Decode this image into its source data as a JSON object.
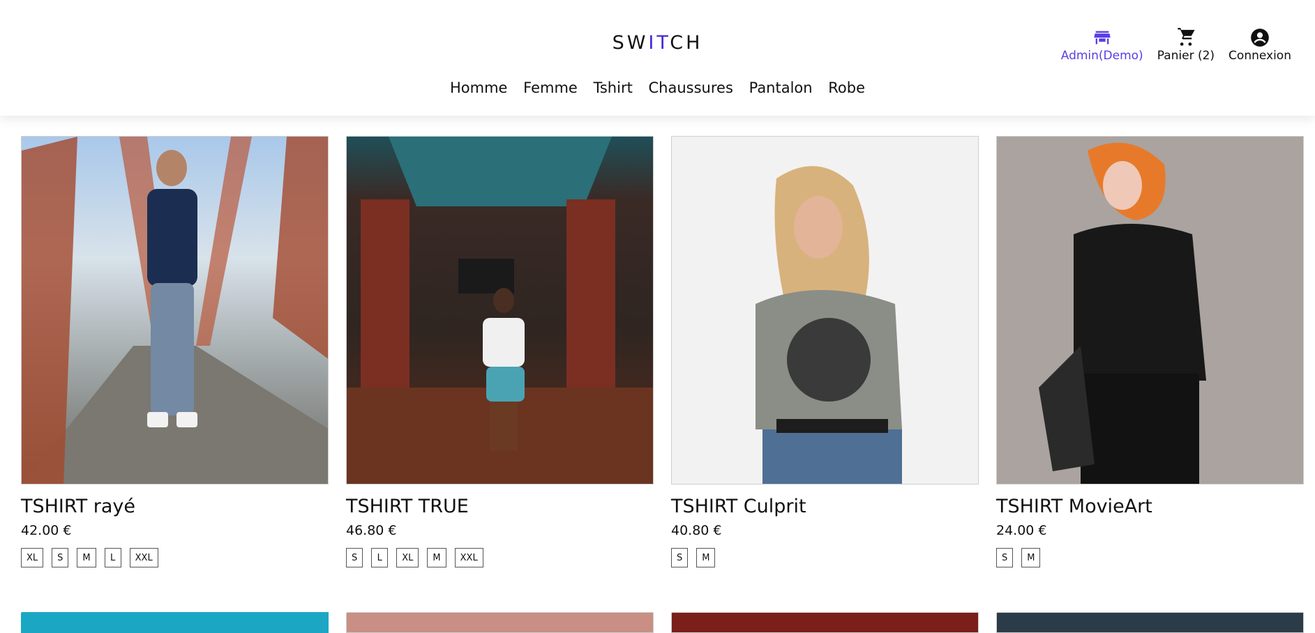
{
  "header": {
    "logo": {
      "part1": "SW",
      "accent": "IT",
      "part2": "CH"
    },
    "nav": [
      "Homme",
      "Femme",
      "Tshirt",
      "Chaussures",
      "Pantalon",
      "Robe"
    ],
    "actions": {
      "admin": {
        "label": "Admin(Demo)",
        "icon": "store-icon"
      },
      "cart": {
        "label": "Panier (2)",
        "icon": "cart-icon"
      },
      "login": {
        "label": "Connexion",
        "icon": "account-circle-icon"
      }
    }
  },
  "colors": {
    "accent": "#4527d6",
    "admin": "#5b3ee6"
  },
  "products": [
    {
      "title": "TSHIRT rayé",
      "price": "42.00 €",
      "sizes": [
        "XL",
        "S",
        "M",
        "L",
        "XXL"
      ]
    },
    {
      "title": "TSHIRT TRUE",
      "price": "46.80 €",
      "sizes": [
        "S",
        "L",
        "XL",
        "M",
        "XXL"
      ]
    },
    {
      "title": "TSHIRT Culprit",
      "price": "40.80 €",
      "sizes": [
        "S",
        "M"
      ]
    },
    {
      "title": "TSHIRT MovieArt",
      "price": "24.00 €",
      "sizes": [
        "S",
        "M"
      ]
    }
  ]
}
